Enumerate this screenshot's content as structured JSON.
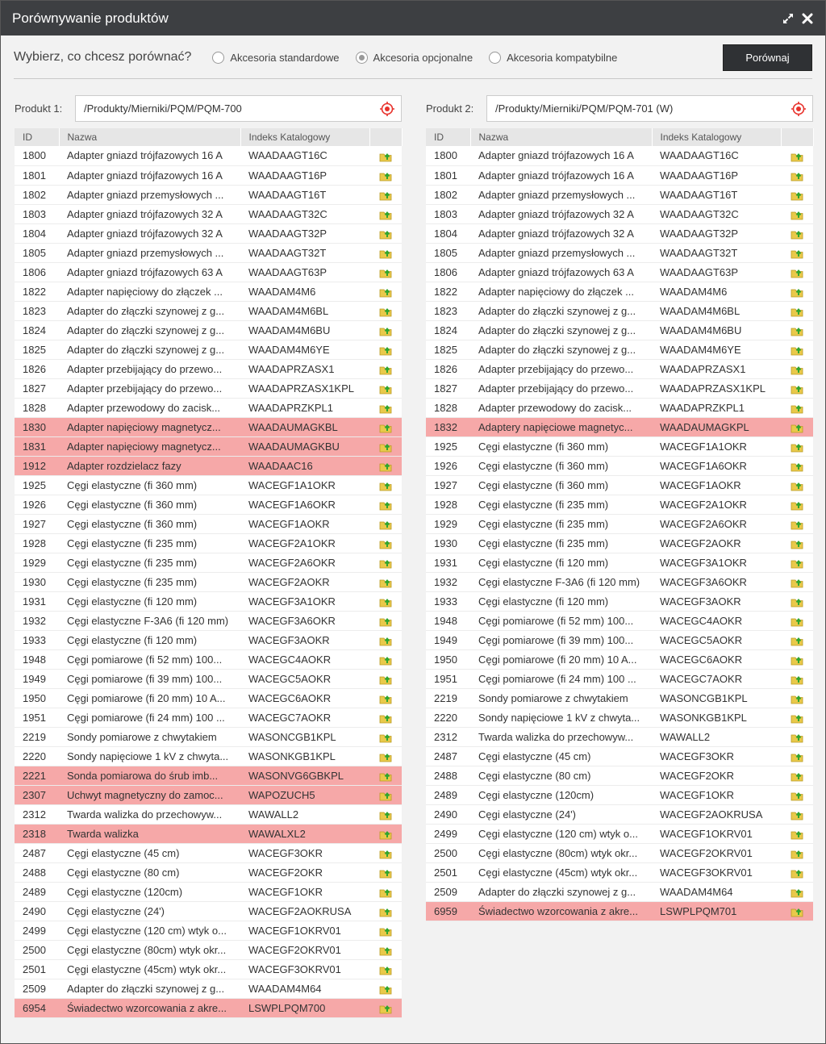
{
  "window": {
    "title": "Porównywanie produktów",
    "maximize_icon": "expand-arrows-icon",
    "close_icon": "close-x-icon"
  },
  "toolbar": {
    "prompt": "Wybierz, co chcesz porównać?",
    "options": [
      {
        "label": "Akcesoria standardowe",
        "selected": false
      },
      {
        "label": "Akcesoria opcjonalne",
        "selected": true
      },
      {
        "label": "Akcesoria kompatybilne",
        "selected": false
      }
    ],
    "compare_label": "Porównaj"
  },
  "columns": {
    "id": "ID",
    "name": "Nazwa",
    "index": "Indeks Katalogowy"
  },
  "colors": {
    "diff_row": "#f6a8a8",
    "title_bar": "#3d3f42",
    "target_icon": "#e8312b"
  },
  "product1": {
    "label": "Produkt 1:",
    "path": "/Produkty/Mierniki/PQM/PQM-700",
    "rows": [
      {
        "id": "1800",
        "name": "Adapter gniazd trójfazowych 16 A",
        "index": "WAADAAGT16C",
        "diff": false
      },
      {
        "id": "1801",
        "name": "Adapter gniazd trójfazowych 16 A",
        "index": "WAADAAGT16P",
        "diff": false
      },
      {
        "id": "1802",
        "name": "Adapter gniazd przemysłowych ...",
        "index": "WAADAAGT16T",
        "diff": false
      },
      {
        "id": "1803",
        "name": "Adapter gniazd trójfazowych 32 A",
        "index": "WAADAAGT32C",
        "diff": false
      },
      {
        "id": "1804",
        "name": "Adapter gniazd trójfazowych 32 A",
        "index": "WAADAAGT32P",
        "diff": false
      },
      {
        "id": "1805",
        "name": "Adapter gniazd przemysłowych ...",
        "index": "WAADAAGT32T",
        "diff": false
      },
      {
        "id": "1806",
        "name": "Adapter gniazd trójfazowych 63 A",
        "index": "WAADAAGT63P",
        "diff": false
      },
      {
        "id": "1822",
        "name": "Adapter napięciowy do złączek ...",
        "index": "WAADAM4M6",
        "diff": false
      },
      {
        "id": "1823",
        "name": "Adapter do złączki szynowej z g...",
        "index": "WAADAM4M6BL",
        "diff": false
      },
      {
        "id": "1824",
        "name": "Adapter do złączki szynowej z g...",
        "index": "WAADAM4M6BU",
        "diff": false
      },
      {
        "id": "1825",
        "name": "Adapter do złączki szynowej z g...",
        "index": "WAADAM4M6YE",
        "diff": false
      },
      {
        "id": "1826",
        "name": "Adapter przebijający do przewo...",
        "index": "WAADAPRZASX1",
        "diff": false
      },
      {
        "id": "1827",
        "name": "Adapter przebijający do przewo...",
        "index": "WAADAPRZASX1KPL",
        "diff": false
      },
      {
        "id": "1828",
        "name": "Adapter przewodowy do zacisk...",
        "index": "WAADAPRZKPL1",
        "diff": false
      },
      {
        "id": "1830",
        "name": "Adapter napięciowy magnetycz...",
        "index": "WAADAUMAGKBL",
        "diff": true
      },
      {
        "id": "1831",
        "name": "Adapter napięciowy magnetycz...",
        "index": "WAADAUMAGKBU",
        "diff": true
      },
      {
        "id": "1912",
        "name": "Adapter rozdzielacz fazy",
        "index": "WAADAAC16",
        "diff": true
      },
      {
        "id": "1925",
        "name": "Cęgi elastyczne (fi 360 mm)",
        "index": "WACEGF1A1OKR",
        "diff": false
      },
      {
        "id": "1926",
        "name": "Cęgi elastyczne (fi 360 mm)",
        "index": "WACEGF1A6OKR",
        "diff": false
      },
      {
        "id": "1927",
        "name": "Cęgi elastyczne (fi 360 mm)",
        "index": "WACEGF1AOKR",
        "diff": false
      },
      {
        "id": "1928",
        "name": "Cęgi elastyczne (fi 235 mm)",
        "index": "WACEGF2A1OKR",
        "diff": false
      },
      {
        "id": "1929",
        "name": "Cęgi elastyczne (fi 235 mm)",
        "index": "WACEGF2A6OKR",
        "diff": false
      },
      {
        "id": "1930",
        "name": "Cęgi elastyczne (fi 235 mm)",
        "index": "WACEGF2AOKR",
        "diff": false
      },
      {
        "id": "1931",
        "name": "Cęgi elastyczne (fi 120 mm)",
        "index": "WACEGF3A1OKR",
        "diff": false
      },
      {
        "id": "1932",
        "name": "Cęgi elastyczne F-3A6 (fi 120 mm)",
        "index": "WACEGF3A6OKR",
        "diff": false
      },
      {
        "id": "1933",
        "name": "Cęgi elastyczne (fi 120 mm)",
        "index": "WACEGF3AOKR",
        "diff": false
      },
      {
        "id": "1948",
        "name": "Cęgi pomiarowe (fi 52 mm) 100...",
        "index": "WACEGC4AOKR",
        "diff": false
      },
      {
        "id": "1949",
        "name": "Cęgi pomiarowe (fi 39 mm) 100...",
        "index": "WACEGC5AOKR",
        "diff": false
      },
      {
        "id": "1950",
        "name": "Cęgi pomiarowe (fi 20 mm) 10 A...",
        "index": "WACEGC6AOKR",
        "diff": false
      },
      {
        "id": "1951",
        "name": "Cęgi pomiarowe (fi 24 mm) 100 ...",
        "index": "WACEGC7AOKR",
        "diff": false
      },
      {
        "id": "2219",
        "name": "Sondy pomiarowe z chwytakiem",
        "index": "WASONCGB1KPL",
        "diff": false
      },
      {
        "id": "2220",
        "name": "Sondy napięciowe 1 kV z chwyta...",
        "index": "WASONKGB1KPL",
        "diff": false
      },
      {
        "id": "2221",
        "name": "Sonda pomiarowa do śrub imb...",
        "index": "WASONVG6GBKPL",
        "diff": true
      },
      {
        "id": "2307",
        "name": "Uchwyt magnetyczny do zamoc...",
        "index": "WAPOZUCH5",
        "diff": true
      },
      {
        "id": "2312",
        "name": "Twarda walizka do przechowyw...",
        "index": "WAWALL2",
        "diff": false
      },
      {
        "id": "2318",
        "name": "Twarda walizka",
        "index": "WAWALXL2",
        "diff": true
      },
      {
        "id": "2487",
        "name": "Cęgi elastyczne (45 cm)",
        "index": "WACEGF3OKR",
        "diff": false
      },
      {
        "id": "2488",
        "name": "Cęgi elastyczne (80 cm)",
        "index": "WACEGF2OKR",
        "diff": false
      },
      {
        "id": "2489",
        "name": "Cęgi elastyczne (120cm)",
        "index": "WACEGF1OKR",
        "diff": false
      },
      {
        "id": "2490",
        "name": "Cęgi elastyczne (24')",
        "index": "WACEGF2AOKRUSA",
        "diff": false
      },
      {
        "id": "2499",
        "name": "Cęgi elastyczne (120 cm) wtyk o...",
        "index": "WACEGF1OKRV01",
        "diff": false
      },
      {
        "id": "2500",
        "name": "Cęgi elastyczne (80cm) wtyk okr...",
        "index": "WACEGF2OKRV01",
        "diff": false
      },
      {
        "id": "2501",
        "name": "Cęgi elastyczne (45cm) wtyk okr...",
        "index": "WACEGF3OKRV01",
        "diff": false
      },
      {
        "id": "2509",
        "name": "Adapter do złączki szynowej z g...",
        "index": "WAADAM4M64",
        "diff": false
      },
      {
        "id": "6954",
        "name": "Świadectwo wzorcowania z akre...",
        "index": "LSWPLPQM700",
        "diff": true
      }
    ]
  },
  "product2": {
    "label": "Produkt 2:",
    "path": "/Produkty/Mierniki/PQM/PQM-701 (W)",
    "rows": [
      {
        "id": "1800",
        "name": "Adapter gniazd trójfazowych 16 A",
        "index": "WAADAAGT16C",
        "diff": false
      },
      {
        "id": "1801",
        "name": "Adapter gniazd trójfazowych 16 A",
        "index": "WAADAAGT16P",
        "diff": false
      },
      {
        "id": "1802",
        "name": "Adapter gniazd przemysłowych ...",
        "index": "WAADAAGT16T",
        "diff": false
      },
      {
        "id": "1803",
        "name": "Adapter gniazd trójfazowych 32 A",
        "index": "WAADAAGT32C",
        "diff": false
      },
      {
        "id": "1804",
        "name": "Adapter gniazd trójfazowych 32 A",
        "index": "WAADAAGT32P",
        "diff": false
      },
      {
        "id": "1805",
        "name": "Adapter gniazd przemysłowych ...",
        "index": "WAADAAGT32T",
        "diff": false
      },
      {
        "id": "1806",
        "name": "Adapter gniazd trójfazowych 63 A",
        "index": "WAADAAGT63P",
        "diff": false
      },
      {
        "id": "1822",
        "name": "Adapter napięciowy do złączek ...",
        "index": "WAADAM4M6",
        "diff": false
      },
      {
        "id": "1823",
        "name": "Adapter do złączki szynowej z g...",
        "index": "WAADAM4M6BL",
        "diff": false
      },
      {
        "id": "1824",
        "name": "Adapter do złączki szynowej z g...",
        "index": "WAADAM4M6BU",
        "diff": false
      },
      {
        "id": "1825",
        "name": "Adapter do złączki szynowej z g...",
        "index": "WAADAM4M6YE",
        "diff": false
      },
      {
        "id": "1826",
        "name": "Adapter przebijający do przewo...",
        "index": "WAADAPRZASX1",
        "diff": false
      },
      {
        "id": "1827",
        "name": "Adapter przebijający do przewo...",
        "index": "WAADAPRZASX1KPL",
        "diff": false
      },
      {
        "id": "1828",
        "name": "Adapter przewodowy do zacisk...",
        "index": "WAADAPRZKPL1",
        "diff": false
      },
      {
        "id": "1832",
        "name": "Adaptery napięciowe magnetyc...",
        "index": "WAADAUMAGKPL",
        "diff": true
      },
      {
        "id": "1925",
        "name": "Cęgi elastyczne (fi 360 mm)",
        "index": "WACEGF1A1OKR",
        "diff": false
      },
      {
        "id": "1926",
        "name": "Cęgi elastyczne (fi 360 mm)",
        "index": "WACEGF1A6OKR",
        "diff": false
      },
      {
        "id": "1927",
        "name": "Cęgi elastyczne (fi 360 mm)",
        "index": "WACEGF1AOKR",
        "diff": false
      },
      {
        "id": "1928",
        "name": "Cęgi elastyczne (fi 235 mm)",
        "index": "WACEGF2A1OKR",
        "diff": false
      },
      {
        "id": "1929",
        "name": "Cęgi elastyczne (fi 235 mm)",
        "index": "WACEGF2A6OKR",
        "diff": false
      },
      {
        "id": "1930",
        "name": "Cęgi elastyczne (fi 235 mm)",
        "index": "WACEGF2AOKR",
        "diff": false
      },
      {
        "id": "1931",
        "name": "Cęgi elastyczne (fi 120 mm)",
        "index": "WACEGF3A1OKR",
        "diff": false
      },
      {
        "id": "1932",
        "name": "Cęgi elastyczne F-3A6 (fi 120 mm)",
        "index": "WACEGF3A6OKR",
        "diff": false
      },
      {
        "id": "1933",
        "name": "Cęgi elastyczne (fi 120 mm)",
        "index": "WACEGF3AOKR",
        "diff": false
      },
      {
        "id": "1948",
        "name": "Cęgi pomiarowe (fi 52 mm) 100...",
        "index": "WACEGC4AOKR",
        "diff": false
      },
      {
        "id": "1949",
        "name": "Cęgi pomiarowe (fi 39 mm) 100...",
        "index": "WACEGC5AOKR",
        "diff": false
      },
      {
        "id": "1950",
        "name": "Cęgi pomiarowe (fi 20 mm) 10 A...",
        "index": "WACEGC6AOKR",
        "diff": false
      },
      {
        "id": "1951",
        "name": "Cęgi pomiarowe (fi 24 mm) 100 ...",
        "index": "WACEGC7AOKR",
        "diff": false
      },
      {
        "id": "2219",
        "name": "Sondy pomiarowe z chwytakiem",
        "index": "WASONCGB1KPL",
        "diff": false
      },
      {
        "id": "2220",
        "name": "Sondy napięciowe 1 kV z chwyta...",
        "index": "WASONKGB1KPL",
        "diff": false
      },
      {
        "id": "2312",
        "name": "Twarda walizka do przechowyw...",
        "index": "WAWALL2",
        "diff": false
      },
      {
        "id": "2487",
        "name": "Cęgi elastyczne (45 cm)",
        "index": "WACEGF3OKR",
        "diff": false
      },
      {
        "id": "2488",
        "name": "Cęgi elastyczne (80 cm)",
        "index": "WACEGF2OKR",
        "diff": false
      },
      {
        "id": "2489",
        "name": "Cęgi elastyczne (120cm)",
        "index": "WACEGF1OKR",
        "diff": false
      },
      {
        "id": "2490",
        "name": "Cęgi elastyczne (24')",
        "index": "WACEGF2AOKRUSA",
        "diff": false
      },
      {
        "id": "2499",
        "name": "Cęgi elastyczne (120 cm) wtyk o...",
        "index": "WACEGF1OKRV01",
        "diff": false
      },
      {
        "id": "2500",
        "name": "Cęgi elastyczne (80cm) wtyk okr...",
        "index": "WACEGF2OKRV01",
        "diff": false
      },
      {
        "id": "2501",
        "name": "Cęgi elastyczne (45cm) wtyk okr...",
        "index": "WACEGF3OKRV01",
        "diff": false
      },
      {
        "id": "2509",
        "name": "Adapter do złączki szynowej z g...",
        "index": "WAADAM4M64",
        "diff": false
      },
      {
        "id": "6959",
        "name": "Świadectwo wzorcowania z akre...",
        "index": "LSWPLPQM701",
        "diff": true
      }
    ]
  }
}
